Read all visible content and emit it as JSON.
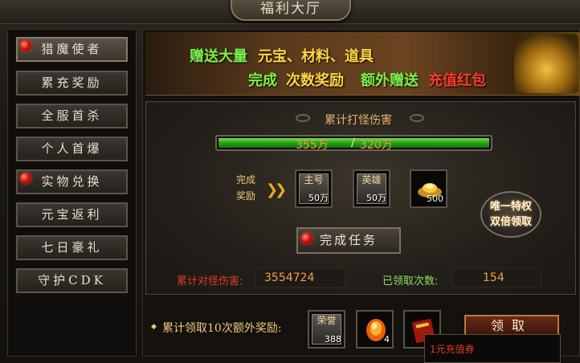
{
  "window": {
    "title": "福利大厅"
  },
  "menu": [
    {
      "label": "猎魔使者",
      "dot": true
    },
    {
      "label": "累充奖励",
      "dot": false
    },
    {
      "label": "全服首杀",
      "dot": false
    },
    {
      "label": "个人首爆",
      "dot": false
    },
    {
      "label": "实物兑换",
      "dot": true
    },
    {
      "label": "元宝返利",
      "dot": false
    },
    {
      "label": "七日豪礼",
      "dot": false
    },
    {
      "label": "守护CDK",
      "dot": false
    }
  ],
  "banner": {
    "line1_a": "赠送大量",
    "line1_b": "元宝、材料、道具",
    "line2_a": "完成",
    "line2_b": "次数奖励",
    "line2_c": "额外赠送",
    "line2_d": "充值红包"
  },
  "task": {
    "section_title": "累计打怪伤害",
    "progress_current": "355万",
    "progress_sep": "/",
    "progress_target": "320万",
    "progress_fraction": 1.0,
    "reward_label_line1": "完成",
    "reward_label_line2": "奖励",
    "rewards": [
      {
        "tag": "主号",
        "count": "50万",
        "icon": "main-account-token-icon"
      },
      {
        "tag": "英雄",
        "count": "50万",
        "icon": "hero-token-icon"
      },
      {
        "tag": "",
        "count": "500",
        "icon": "gold-ingot-icon"
      }
    ],
    "special_line1": "唯一特权",
    "special_line2": "双倍领取",
    "complete_button": "完成任务"
  },
  "stats": {
    "damage_label": "累计对怪伤害:",
    "damage_value": "3554724",
    "claimed_label": "已领取次数:",
    "claimed_value": "154"
  },
  "bonus": {
    "label": "累计领取10次额外奖励:",
    "items": [
      {
        "tag": "荣誉",
        "count": "388",
        "icon": "honor-badge-icon"
      },
      {
        "tag": "",
        "count": "4",
        "icon": "fire-gem-icon"
      },
      {
        "tag": "",
        "count": "",
        "icon": "red-book-icon"
      }
    ],
    "claim_button": "领取",
    "tooltip": "1元充值券"
  },
  "colors": {
    "accent_orange": "#f2a23e",
    "progress_green": "#2aa018",
    "alert_red": "#d3160c"
  }
}
